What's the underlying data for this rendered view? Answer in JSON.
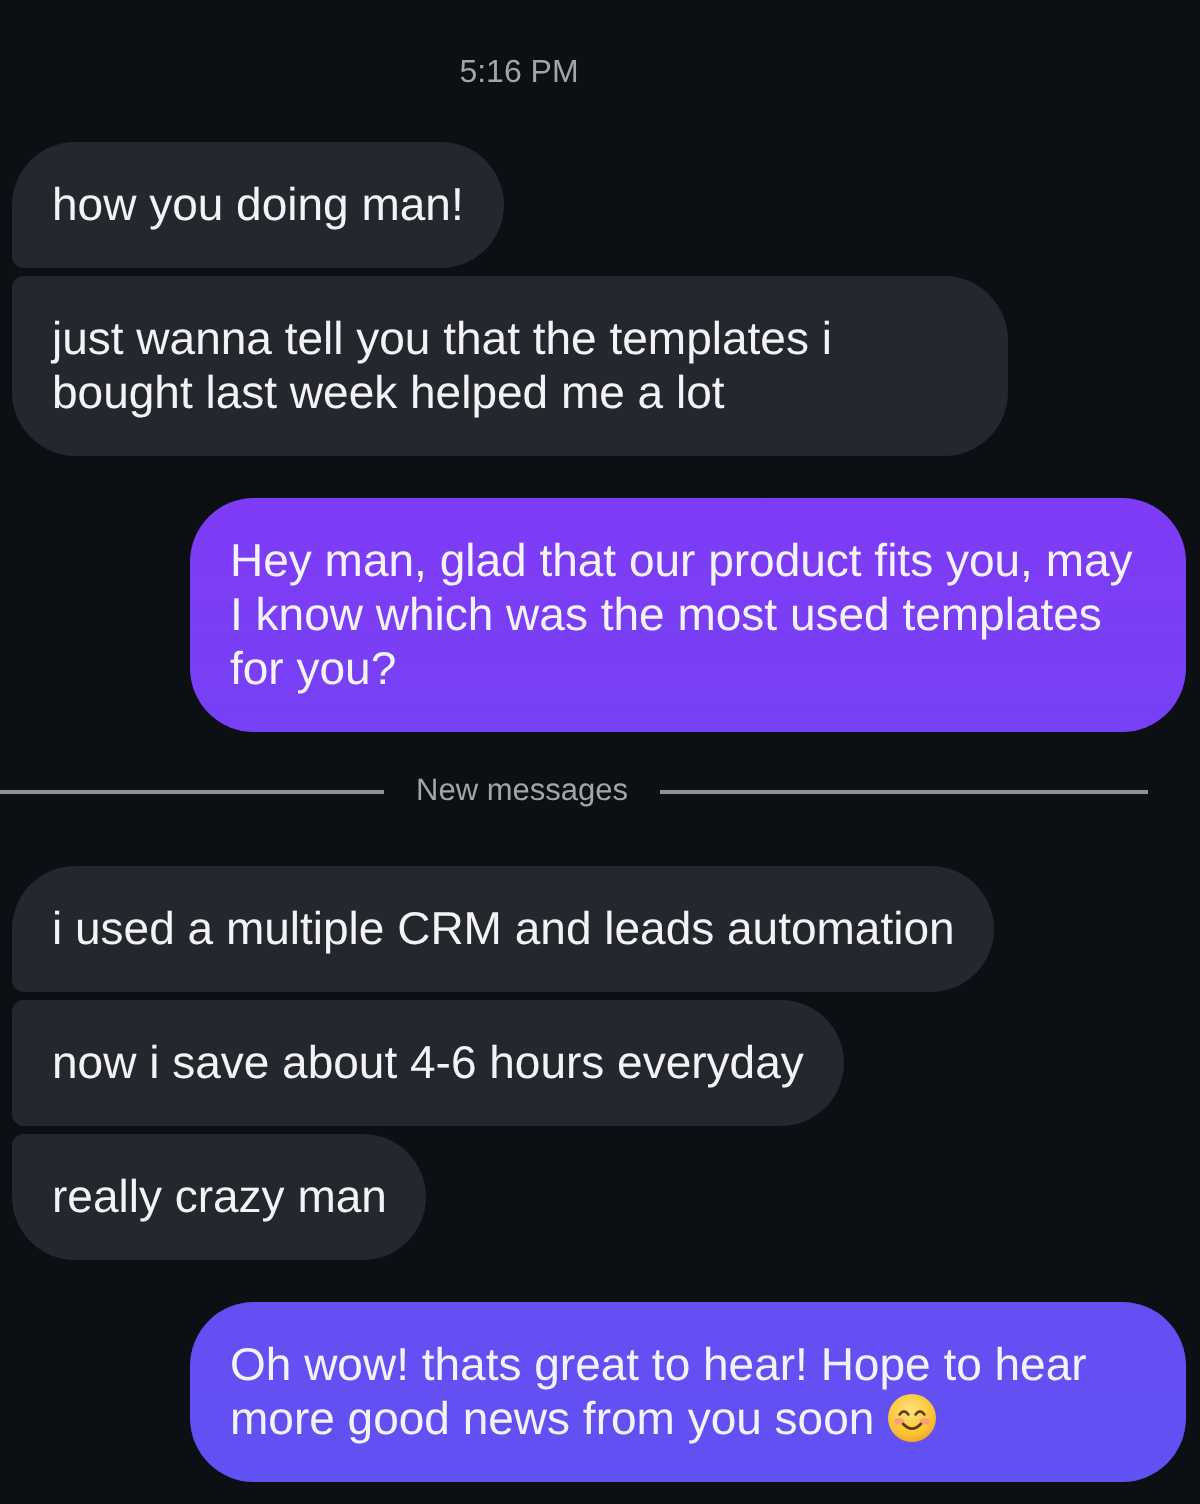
{
  "timestamp": "5:16 PM",
  "thread": [
    {
      "kind": "received",
      "text": "how you doing man!"
    },
    {
      "kind": "received",
      "text": "just wanna tell you that the templates i bought last week helped me a lot"
    },
    {
      "kind": "sent",
      "text": "Hey man, glad that our product fits you, may I know which was the most used templates for you?"
    },
    {
      "kind": "divider",
      "label": "New messages"
    },
    {
      "kind": "received",
      "text": "i used a multiple CRM and leads automation"
    },
    {
      "kind": "received",
      "text": "now i save about 4-6 hours everyday"
    },
    {
      "kind": "received",
      "text": "really crazy man"
    },
    {
      "kind": "sent",
      "text": "Oh wow! thats great to hear! Hope to hear more good news from you soon",
      "trailing_emoji": true
    }
  ]
}
